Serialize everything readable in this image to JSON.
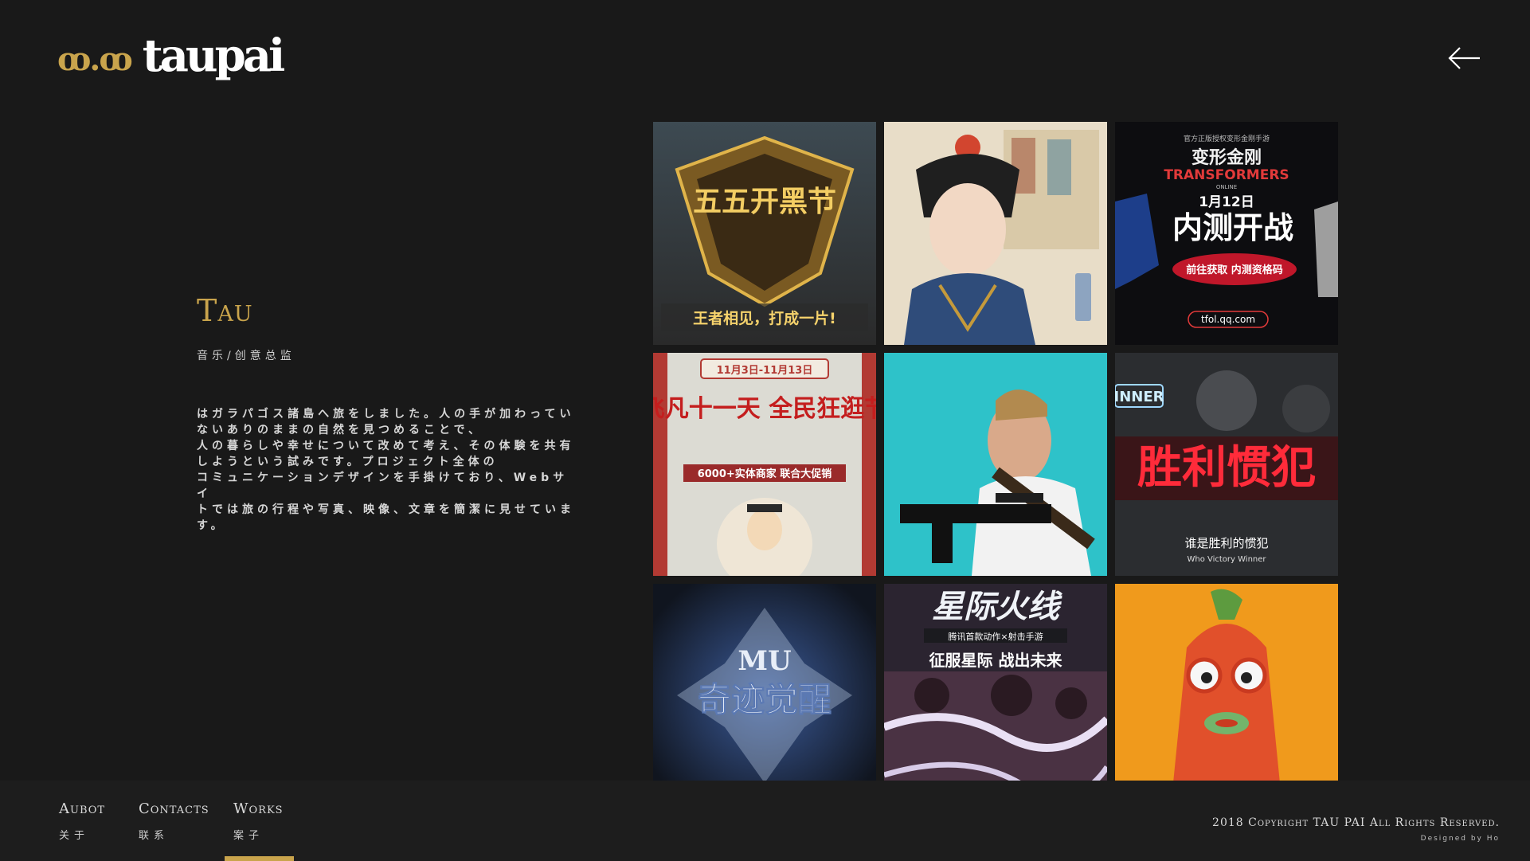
{
  "header": {
    "logo_mark": "ꝏ.ꝏ",
    "logo_word": "taupai",
    "back_icon": "arrow-left-icon"
  },
  "intro": {
    "title": "Tau",
    "role": "音乐/创意总监",
    "description_lines": [
      "はガラパゴス諸島へ旅をしました。人の手が加わってい",
      "ないありのままの自然を見つめることで、",
      "人の暮らしや幸せについて改めて考え、その体験を共有",
      "しようという試みです。プロジェクト全体の",
      "コミュニケーションデザインを手掛けており、Webサイ",
      "トでは旅の行程や写真、映像、文章を簡潔に見せていま",
      "す。"
    ]
  },
  "gallery": {
    "tiles": [
      {
        "caption": "王者相见，打成一片!",
        "headline": "五五开黑节"
      },
      {
        "caption": ""
      },
      {
        "top": "官方正版授权变形金刚手游",
        "headline": "变形金刚",
        "brand": "TRANSFORMERS",
        "sub": "ONLINE",
        "date": "1月12日",
        "main": "内测开战",
        "badge": "前往获取 内测资格码",
        "url": "tfol.qq.com"
      },
      {
        "date": "11月3日-11月13日",
        "headline": "飞凡十一天 全民狂逛节",
        "promo": "6000+实体商家 联合大促销"
      },
      {
        "caption": ""
      },
      {
        "tag": "INNER",
        "headline": "胜利惯犯",
        "caption_cn": "谁是胜利的惯犯",
        "caption_en": "Who Victory Winner"
      },
      {
        "logo": "MU",
        "headline": "奇迹觉醒"
      },
      {
        "headline": "星际火线",
        "sub": "腾讯首款动作×射击手游",
        "tagline": "征服星际 战出未来"
      },
      {
        "caption": ""
      }
    ]
  },
  "footer": {
    "nav": [
      {
        "en": "Aubot",
        "cn": "关于"
      },
      {
        "en": "Contacts",
        "cn": "联系"
      },
      {
        "en": "Works",
        "cn": "案子"
      }
    ],
    "active_index": 2,
    "copyright": "2018 Copyright TAU PAI All Rights Reserved.",
    "credit": "Designed by Ho"
  },
  "colors": {
    "bg": "#191919",
    "accent": "#c9a44c",
    "footer_bg": "#1d1d1d"
  }
}
